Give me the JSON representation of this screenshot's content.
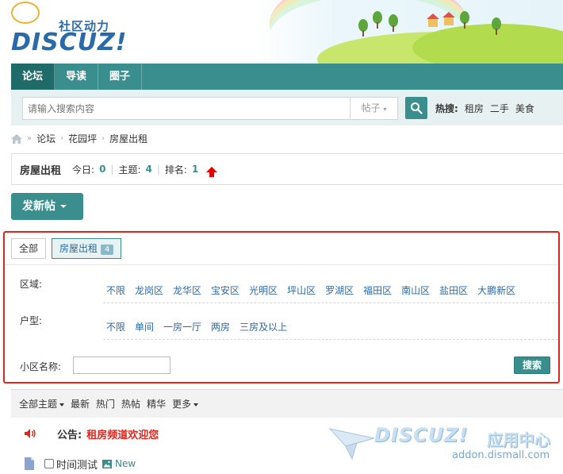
{
  "header": {
    "logo_cn": "社区动力",
    "logo_en": "DISCUZ!"
  },
  "nav": {
    "items": [
      {
        "label": "论坛",
        "active": true
      },
      {
        "label": "导读",
        "active": false
      },
      {
        "label": "圈子",
        "active": false
      }
    ]
  },
  "search": {
    "placeholder": "请输入搜索内容",
    "type_label": "帖子",
    "hot_label": "热搜:",
    "hot_items": [
      "租房",
      "二手",
      "美食"
    ]
  },
  "breadcrumb": {
    "items": [
      "论坛",
      "花园坪",
      "房屋出租"
    ]
  },
  "forum": {
    "title": "房屋出租",
    "today_label": "今日:",
    "today_value": "0",
    "threads_label": "主题:",
    "threads_value": "4",
    "rank_label": "排名:",
    "rank_value": "1"
  },
  "new_post_label": "发新帖",
  "filter": {
    "tab_all": "全部",
    "tab_current": "房屋出租",
    "tab_current_count": "4",
    "area_label": "区域:",
    "area_options": [
      "不限",
      "龙岗区",
      "龙华区",
      "宝安区",
      "光明区",
      "坪山区",
      "罗湖区",
      "福田区",
      "南山区",
      "盐田区",
      "大鹏新区"
    ],
    "type_label": "户型:",
    "type_options": [
      "不限",
      "单间",
      "一房一厅",
      "两房",
      "三房及以上"
    ],
    "community_label": "小区名称:",
    "search_button": "搜索"
  },
  "list_header": {
    "all_threads": "全部主题",
    "latest": "最新",
    "hot": "热门",
    "hot_posts": "热帖",
    "digest": "精华",
    "more": "更多"
  },
  "announcement": {
    "label": "公告:",
    "text": "租房频道欢迎您"
  },
  "thread": {
    "title": "时间测试",
    "new_tag": "New"
  },
  "watermark": {
    "en": "DISCUZ!",
    "cn": "应用中心",
    "url": "addon.dismall.com"
  },
  "colors": {
    "primary": "#3a8f8e",
    "link": "#2b6aa8",
    "highlight_border": "#e1251b",
    "announce": "#e1251b"
  }
}
